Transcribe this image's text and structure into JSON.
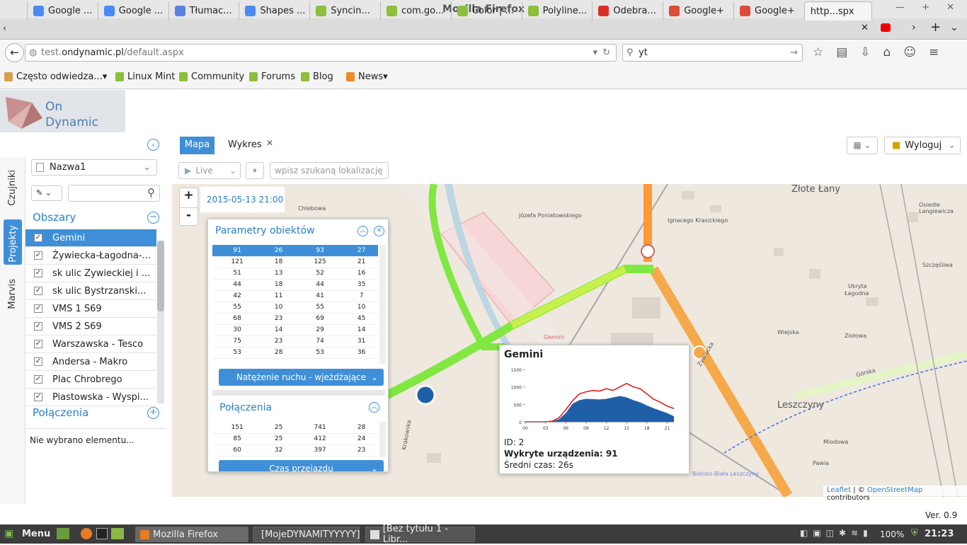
{
  "browser": {
    "window_title": "Mozilla Firefox",
    "tabs": [
      "Google ...",
      "Google ...",
      "Tłumac...",
      "Shapes ...",
      "Syncin...",
      "com.go...",
      "Color | ...",
      "Polyline...",
      "Odebra...",
      "Google+",
      "Google+",
      "http...spx"
    ],
    "url_host": "test.ondynamic.pl",
    "url_path": "/default.aspx",
    "url_prefix": "test.",
    "url_domain": "ondynamic.pl",
    "search_value": "yt",
    "bookmarks": [
      "Często odwiedza...",
      "Linux Mint",
      "Community",
      "Forums",
      "Blog",
      "News"
    ]
  },
  "app": {
    "logo_line1": "On",
    "logo_line2": "Dynamic",
    "rail_tabs": [
      "Czujniki",
      "Projekty",
      "Marvis"
    ],
    "main_tabs": [
      "Mapa",
      "Wykres"
    ],
    "logout_label": "Wyloguj",
    "live_label": "Live",
    "location_placeholder": "wpisz szukaną lokalizację",
    "name_select": "Nazwa1",
    "section_areas": "Obszary",
    "section_connections": "Połączenia",
    "areas": [
      "Gemini",
      "Żywiecka-Łagodna-...",
      "sk ulic Zywieckiej i ...",
      "sk ulic Bystrzanski...",
      "VMS 1 S69",
      "VMS 2 S69",
      "Warszawska - Tesco",
      "Andersa - Makro",
      "Plac Chrobrego",
      "Piastowska - Wyspi..."
    ],
    "no_selection": "Nie wybrano elementu...",
    "version": "Ver. 0.9"
  },
  "map": {
    "timestamp": "2015-05-13 21:00",
    "zoom_in": "+",
    "zoom_out": "-",
    "attribution_leaflet": "Leaflet",
    "attribution_osm": "OpenStreetMap",
    "attribution_rest": "contributors",
    "street_labels": [
      "Żywiecka",
      "Leszczyny",
      "Złote Łany",
      "Gemini",
      "Łagodna",
      "Ignacego Krasickiego",
      "Józefa Poniatowskiego",
      "Bielsko-Biała Leszczyny",
      "Górska",
      "Krakowska",
      "Chlebowa",
      "Ziołowa",
      "Wiejska",
      "Miodowa",
      "Pawia",
      "Ukryta",
      "Szczęśliwa",
      "Osiedle Langiewicza"
    ],
    "params_panel": {
      "title": "Parametry obiektów",
      "rows": [
        [
          91,
          26,
          93,
          27
        ],
        [
          121,
          18,
          125,
          21
        ],
        [
          51,
          13,
          52,
          16
        ],
        [
          44,
          18,
          44,
          35
        ],
        [
          42,
          11,
          41,
          7
        ],
        [
          55,
          10,
          55,
          10
        ],
        [
          68,
          23,
          69,
          45
        ],
        [
          30,
          14,
          29,
          14
        ],
        [
          75,
          23,
          74,
          31
        ],
        [
          53,
          28,
          53,
          36
        ]
      ],
      "dropdown": "Natężenie ruchu - wjeżdżające",
      "connections_title": "Połączenia",
      "conn_rows": [
        [
          151,
          25,
          741,
          28
        ],
        [
          85,
          25,
          412,
          24
        ],
        [
          60,
          32,
          397,
          23
        ]
      ],
      "conn_dropdown": "Czas przejazdu"
    },
    "popup": {
      "title": "Gemini",
      "id_line": "ID: 2",
      "devices_label": "Wykryte urządzenia: 91",
      "avg_label": "Średni czas: 26s"
    }
  },
  "chart_data": {
    "type": "area",
    "title": "",
    "x": [
      0,
      1,
      2,
      3,
      4,
      5,
      6,
      7,
      8,
      9,
      10,
      11,
      12,
      13,
      14,
      15,
      16,
      17,
      18,
      19,
      20,
      21,
      22
    ],
    "x_tick_labels": [
      "00",
      "03",
      "06",
      "09",
      "12",
      "15",
      "18",
      "21"
    ],
    "y_tick_labels": [
      "0",
      "500",
      "1000",
      "1500"
    ],
    "ylim": [
      0,
      1500
    ],
    "series": [
      {
        "values": [
          0,
          0,
          0,
          0,
          10,
          80,
          250,
          520,
          620,
          660,
          650,
          640,
          660,
          700,
          740,
          700,
          620,
          560,
          470,
          390,
          320,
          250,
          160
        ]
      },
      {
        "values": [
          0,
          0,
          0,
          0,
          20,
          120,
          350,
          600,
          800,
          860,
          900,
          880,
          950,
          900,
          1000,
          1100,
          1000,
          950,
          800,
          650,
          560,
          450,
          380
        ]
      }
    ],
    "colors": [
      "#1f5fa8",
      "#e01010"
    ]
  },
  "taskbar": {
    "menu": "Menu",
    "tasks": [
      "Mozilla Firefox",
      "[MojeDYNAMITYYYYY]",
      "[Bez tytułu 1 - Libr..."
    ],
    "battery": "100%",
    "clock": "21:23"
  }
}
